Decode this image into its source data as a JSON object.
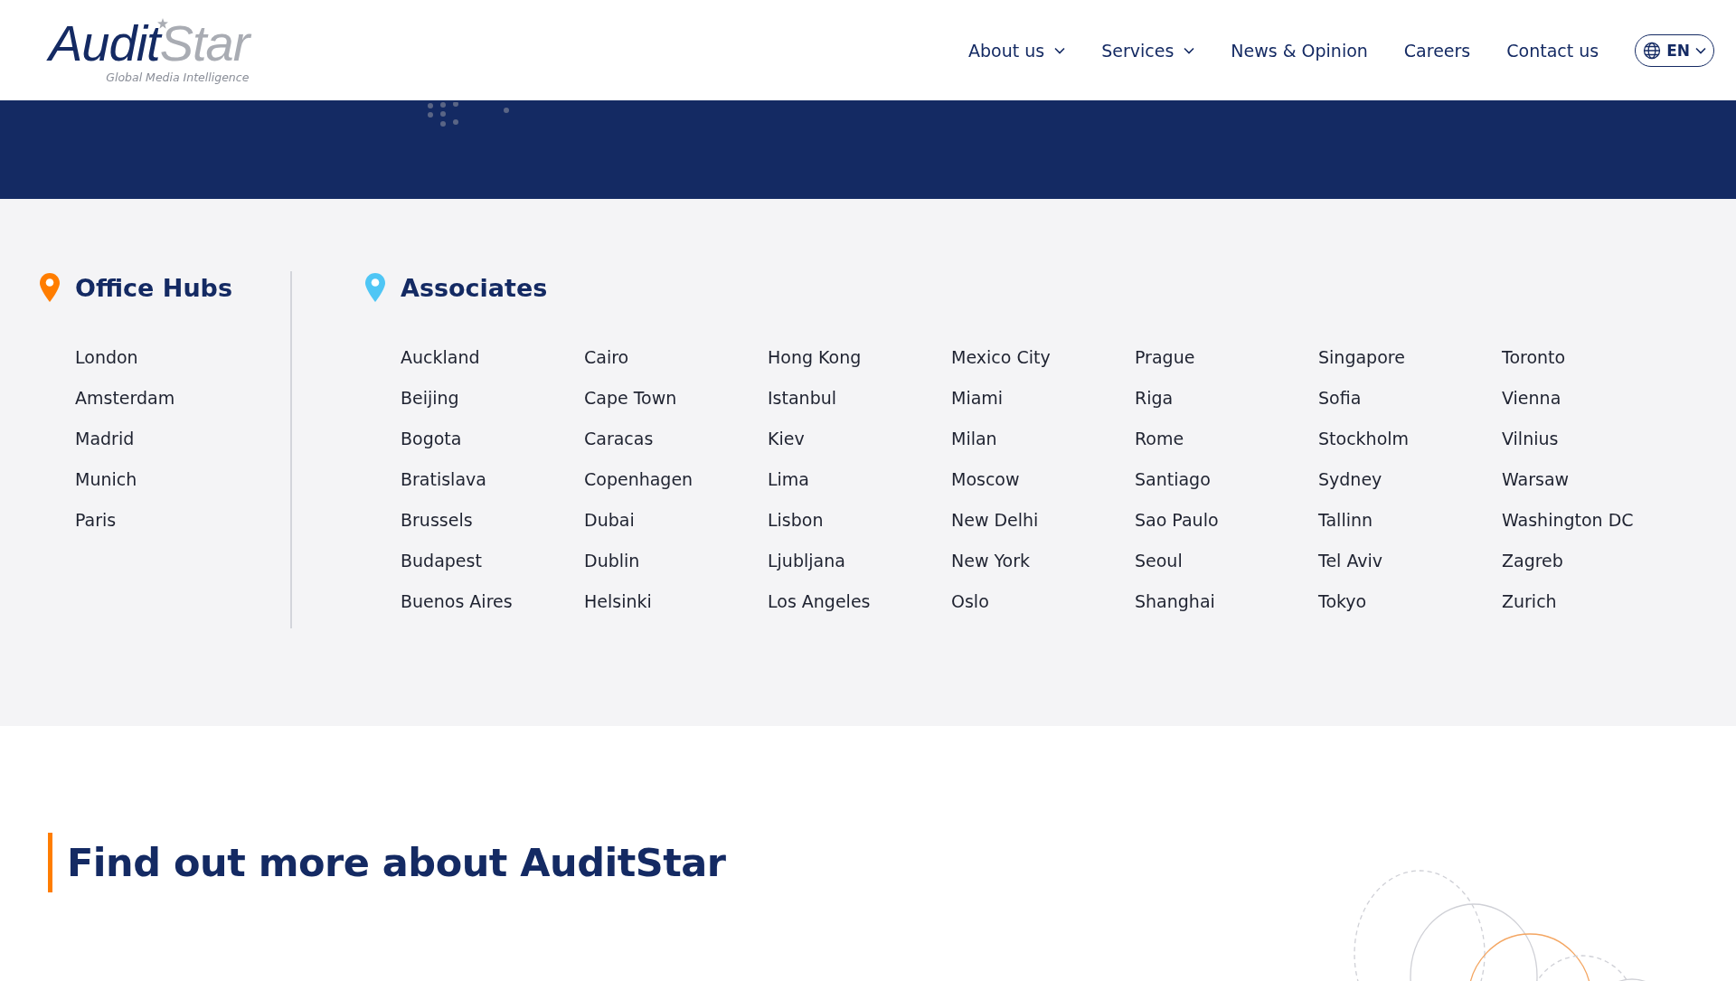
{
  "header": {
    "logo": {
      "primary": "Audit",
      "secondary": "Star",
      "tagline": "Global Media Intelligence"
    },
    "nav": [
      {
        "label": "About us",
        "has_dropdown": true
      },
      {
        "label": "Services",
        "has_dropdown": true
      },
      {
        "label": "News & Opinion",
        "has_dropdown": false
      },
      {
        "label": "Careers",
        "has_dropdown": false
      },
      {
        "label": "Contact us",
        "has_dropdown": false
      }
    ],
    "language": {
      "label": "EN",
      "has_dropdown": true
    }
  },
  "locations": [
    {
      "title": "Office Hubs",
      "color": "#ff7d00",
      "columns": [
        [
          "London",
          "Amsterdam",
          "Madrid",
          "Munich",
          "Paris"
        ]
      ]
    },
    {
      "title": "Associates",
      "color": "#4fc6f5",
      "columns": [
        [
          "Auckland",
          "Beijing",
          "Bogota",
          "Bratislava",
          "Brussels",
          "Budapest",
          "Buenos Aires"
        ],
        [
          "Cairo",
          "Cape Town",
          "Caracas",
          "Copenhagen",
          "Dubai",
          "Dublin",
          "Helsinki"
        ],
        [
          "Hong Kong",
          "Istanbul",
          "Kiev",
          "Lima",
          "Lisbon",
          "Ljubljana",
          "Los Angeles"
        ],
        [
          "Mexico City",
          "Miami",
          "Milan",
          "Moscow",
          "New Delhi",
          "New York",
          "Oslo"
        ],
        [
          "Prague",
          "Riga",
          "Rome",
          "Santiago",
          "Sao Paulo",
          "Seoul",
          "Shanghai"
        ],
        [
          "Singapore",
          "Sofia",
          "Stockholm",
          "Sydney",
          "Tallinn",
          "Tel Aviv",
          "Tokyo"
        ],
        [
          "Toronto",
          "Vienna",
          "Vilnius",
          "Warsaw",
          "Washington DC",
          "Zagreb",
          "Zurich"
        ]
      ]
    }
  ],
  "cta": {
    "heading": "Find out more about AuditStar"
  }
}
